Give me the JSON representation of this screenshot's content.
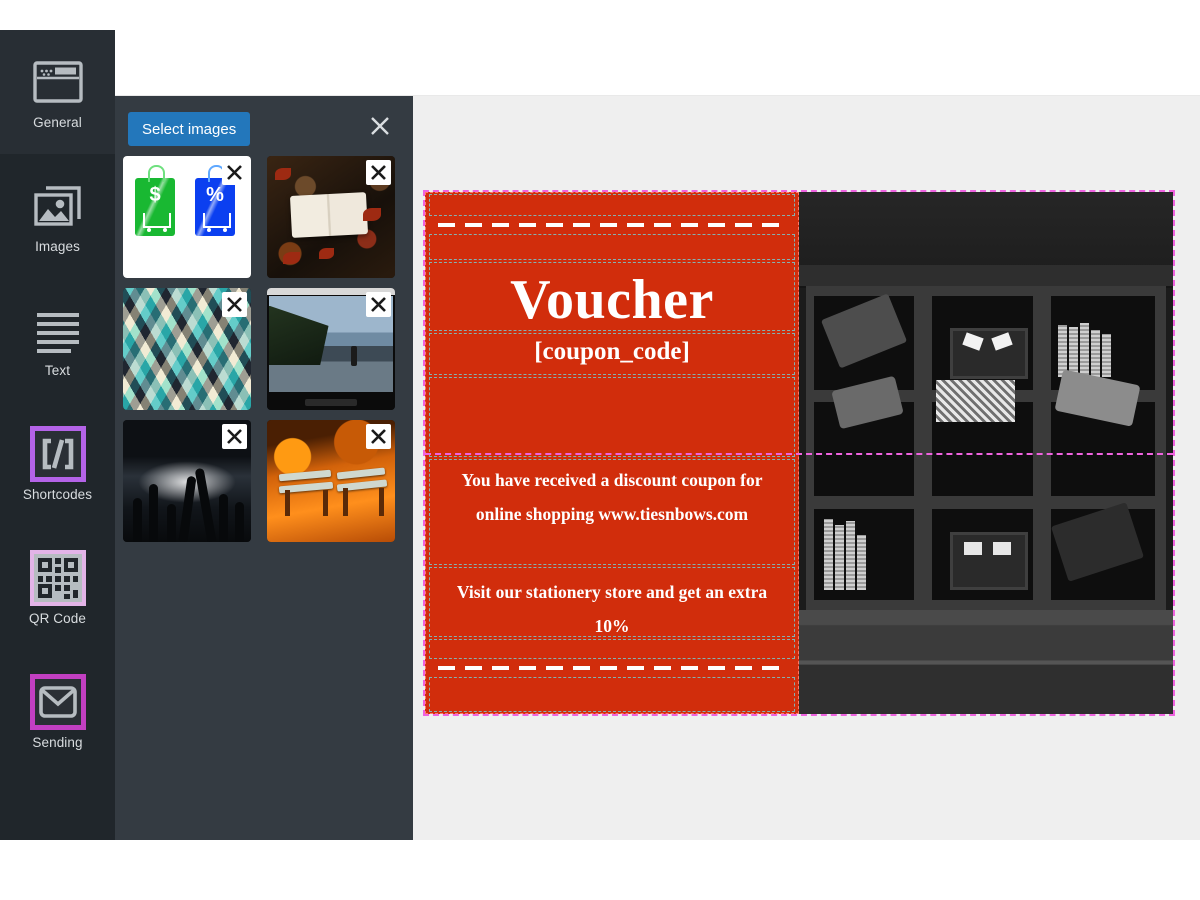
{
  "sidebar": {
    "items": [
      {
        "label": "General",
        "icon": "window-icon",
        "active": true
      },
      {
        "label": "Images",
        "icon": "image-icon",
        "active": false
      },
      {
        "label": "Text",
        "icon": "text-lines-icon",
        "active": false
      },
      {
        "label": "Shortcodes",
        "icon": "code-brackets-icon",
        "active": false
      },
      {
        "label": "QR Code",
        "icon": "qr-code-icon",
        "active": false
      },
      {
        "label": "Sending",
        "icon": "envelope-icon",
        "active": false
      }
    ]
  },
  "images_panel": {
    "select_button_label": "Select images",
    "close_icon": "close-icon",
    "thumbnails": [
      {
        "alt": "Green and blue discount price tags with shopping carts",
        "delete_icon": "close-icon"
      },
      {
        "alt": "Open book on autumn leaves and branches",
        "delete_icon": "close-icon"
      },
      {
        "alt": "Teal and cream geometric triangle pattern",
        "delete_icon": "close-icon"
      },
      {
        "alt": "Television showing coastal cliff and surfer",
        "delete_icon": "close-icon"
      },
      {
        "alt": "Concert crowd with raised hands and stage lights",
        "delete_icon": "close-icon"
      },
      {
        "alt": "Park benches among orange autumn leaves",
        "delete_icon": "close-icon"
      }
    ]
  },
  "voucher": {
    "title": "Voucher",
    "code": "[coupon_code]",
    "body_line_1": "You have received a discount coupon for",
    "body_line_2": "online shopping www.tiesnbows.com",
    "footer_line_1": "Visit our stationery store and get an extra",
    "footer_line_2": "10%",
    "image_alt": "Grayscale photo of a shelving unit with bow ties and books"
  },
  "colors": {
    "voucher_background": "#d12d0c",
    "accent_button": "#2377bb",
    "selection_outline": "#ef63e0",
    "rail_background": "#20262b",
    "flyout_background": "#343b42",
    "canvas_background": "#efefef",
    "voucher_text": "#ffffff"
  }
}
